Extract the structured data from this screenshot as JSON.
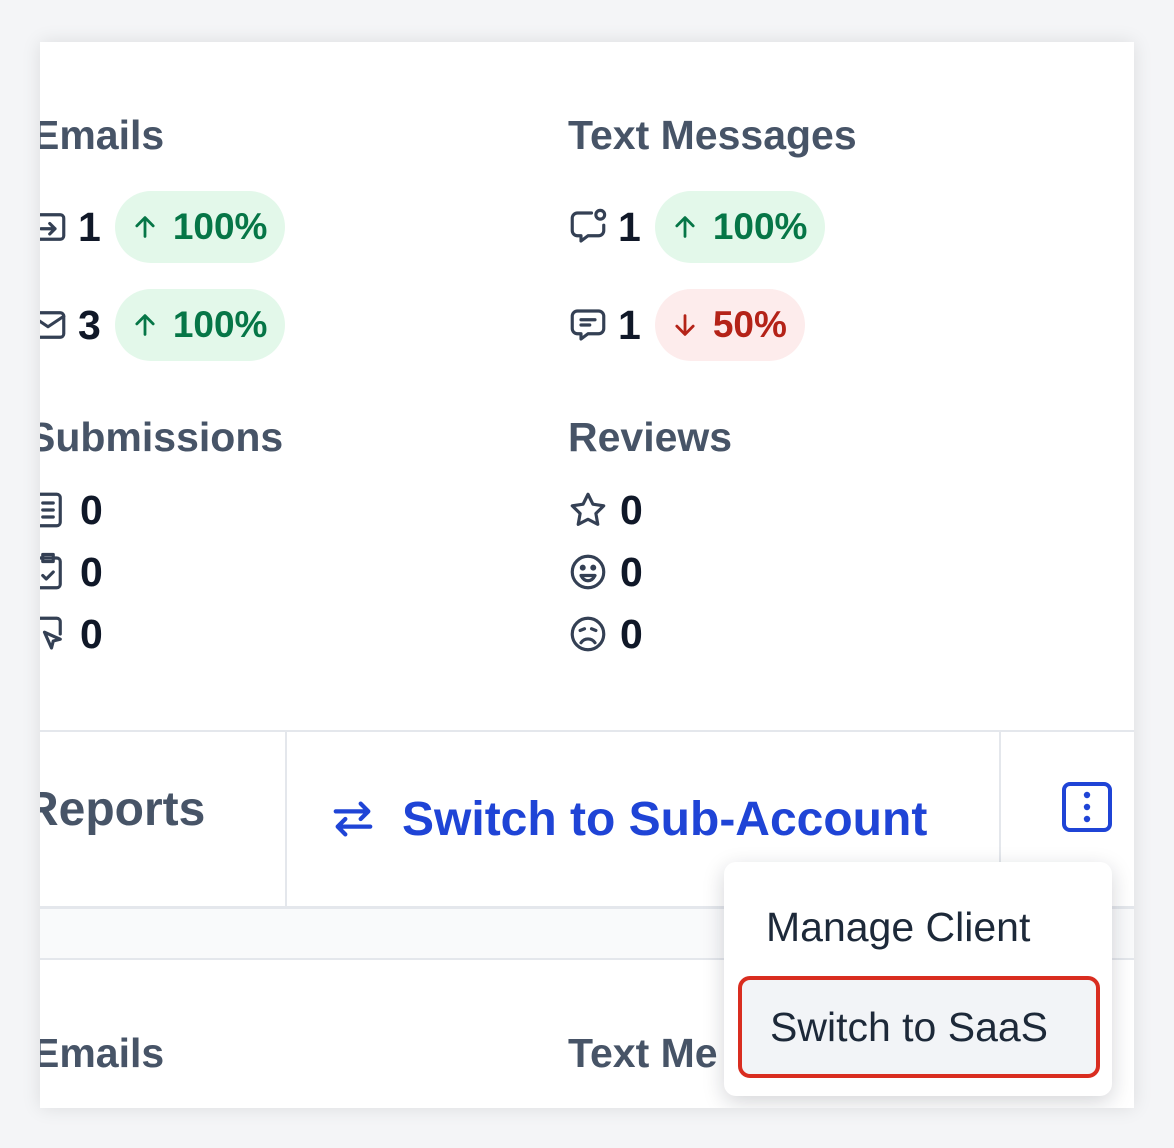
{
  "sections": {
    "emails": {
      "title": "Emails",
      "rows": [
        {
          "icon": "email-sent-icon",
          "value": "1",
          "trend": "100%",
          "direction": "up"
        },
        {
          "icon": "email-open-icon",
          "value": "3",
          "trend": "100%",
          "direction": "up"
        }
      ]
    },
    "text_messages": {
      "title": "Text Messages",
      "rows": [
        {
          "icon": "message-notification-icon",
          "value": "1",
          "trend": "100%",
          "direction": "up"
        },
        {
          "icon": "message-text-icon",
          "value": "1",
          "trend": "50%",
          "direction": "down"
        }
      ]
    },
    "submissions": {
      "title": "Submissions",
      "rows": [
        {
          "icon": "form-icon",
          "value": "0"
        },
        {
          "icon": "survey-icon",
          "value": "0"
        },
        {
          "icon": "funnel-click-icon",
          "value": "0"
        }
      ]
    },
    "reviews": {
      "title": "Reviews",
      "rows": [
        {
          "icon": "star-icon",
          "value": "0"
        },
        {
          "icon": "happy-face-icon",
          "value": "0"
        },
        {
          "icon": "sad-face-icon",
          "value": "0"
        }
      ]
    }
  },
  "action_bar": {
    "reports_label": "Reports",
    "switch_label": "Switch to Sub-Account"
  },
  "dropdown": {
    "items": [
      "Manage Client",
      "Switch to SaaS"
    ]
  },
  "lower_card": {
    "emails_title": "Emails",
    "text_messages_title": "Text Me"
  },
  "colors": {
    "accent": "#1f44d6",
    "positive": "#067647",
    "negative": "#b42318",
    "highlight_border": "#d92d20"
  }
}
